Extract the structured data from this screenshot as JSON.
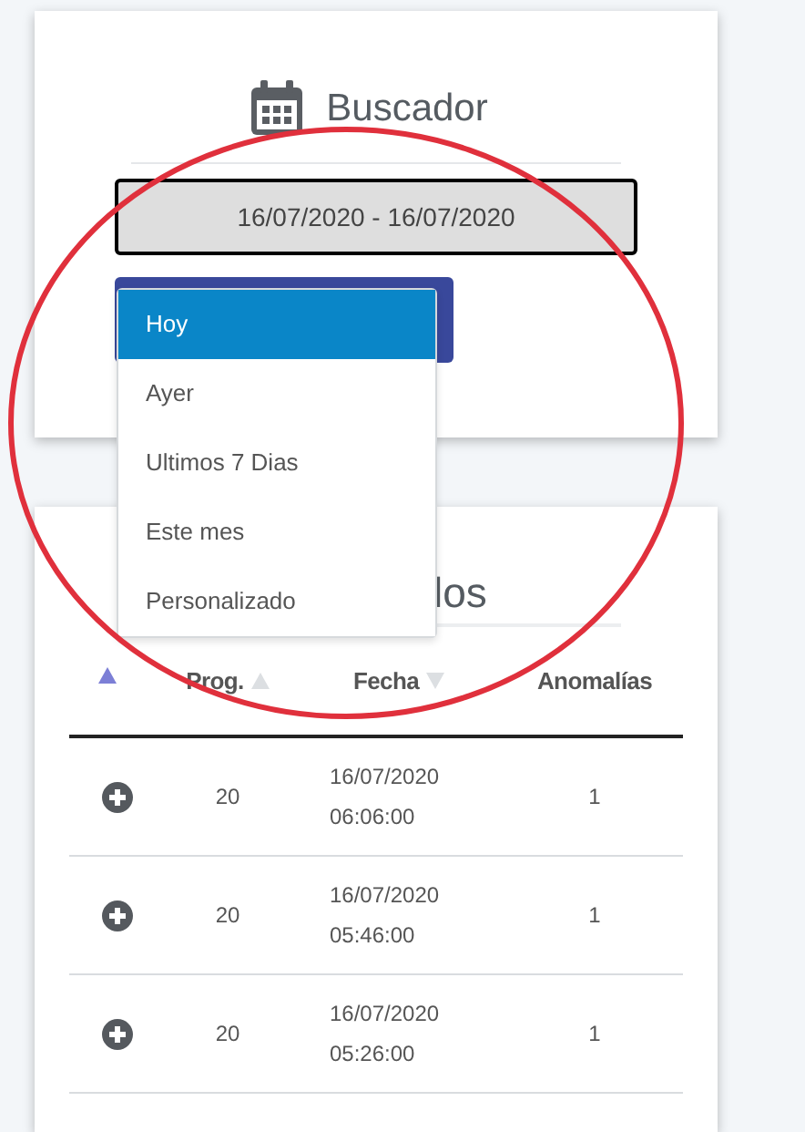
{
  "search_card": {
    "title": "Buscador",
    "date_range": "16/07/2020 - 16/07/2020"
  },
  "range_menu": {
    "items": [
      {
        "label": "Hoy",
        "selected": true
      },
      {
        "label": "Ayer",
        "selected": false
      },
      {
        "label": "Ultimos 7 Dias",
        "selected": false
      },
      {
        "label": "Este mes",
        "selected": false
      },
      {
        "label": "Personalizado",
        "selected": false
      }
    ]
  },
  "results_card": {
    "title": "los",
    "table": {
      "columns": [
        {
          "kind": "expander",
          "ascending": true,
          "active": true
        },
        {
          "kind": "text",
          "label": "Prog.",
          "ascending": true,
          "active": false
        },
        {
          "kind": "text",
          "label": "Fecha",
          "ascending": false,
          "active": false
        },
        {
          "kind": "text",
          "label": "Anomalías"
        }
      ],
      "rows": [
        {
          "prog": "20",
          "date": "16/07/2020",
          "time": "06:06:00",
          "anomalies": "1"
        },
        {
          "prog": "20",
          "date": "16/07/2020",
          "time": "05:46:00",
          "anomalies": "1"
        },
        {
          "prog": "20",
          "date": "16/07/2020",
          "time": "05:26:00",
          "anomalies": "1"
        }
      ]
    }
  },
  "annotation": {
    "kind": "ellipse"
  }
}
